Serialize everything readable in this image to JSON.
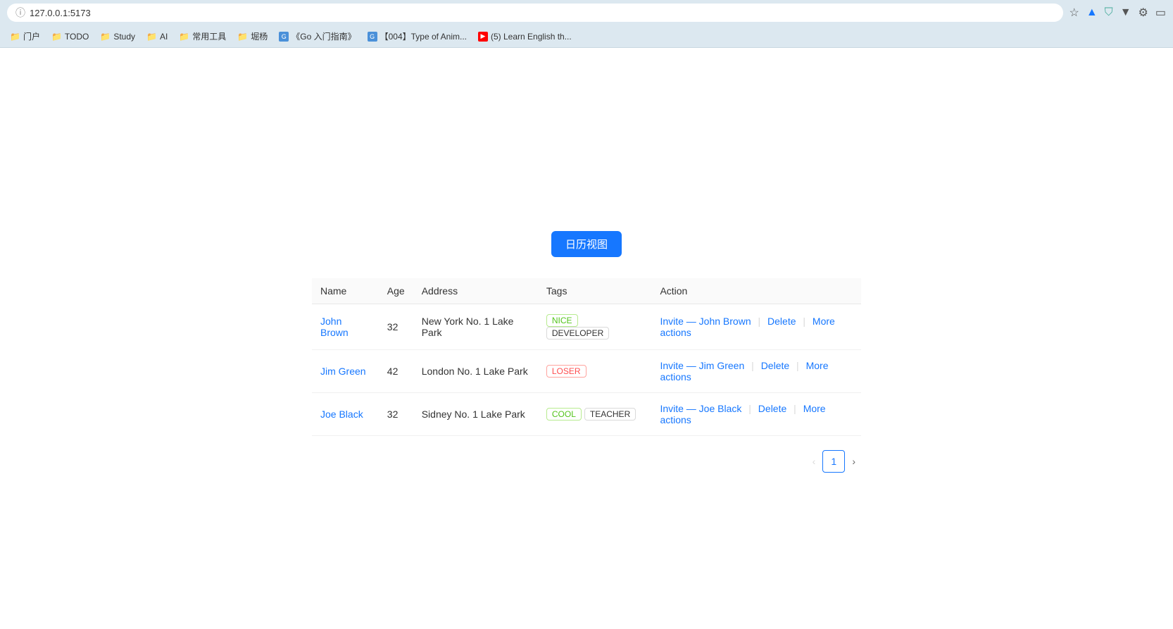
{
  "browser": {
    "address": "127.0.0.1:5173",
    "bookmarks": [
      {
        "label": "门户",
        "type": "folder",
        "color": "yellow"
      },
      {
        "label": "TODO",
        "type": "folder",
        "color": "yellow"
      },
      {
        "label": "Study",
        "type": "folder",
        "color": "yellow"
      },
      {
        "label": "AI",
        "type": "folder",
        "color": "yellow"
      },
      {
        "label": "常用工具",
        "type": "folder",
        "color": "yellow"
      },
      {
        "label": "堀杨",
        "type": "folder",
        "color": "yellow"
      },
      {
        "label": "《Go 入门指南》",
        "type": "favicon",
        "faviconType": "go"
      },
      {
        "label": "【004】Type of Anim...",
        "type": "favicon",
        "faviconType": "go"
      },
      {
        "label": "(5) Learn English th...",
        "type": "favicon",
        "faviconType": "yt"
      }
    ]
  },
  "page": {
    "calendar_button": "日历视图",
    "table": {
      "columns": [
        "Name",
        "Age",
        "Address",
        "Tags",
        "Action"
      ],
      "rows": [
        {
          "name": "John Brown",
          "age": 32,
          "address": "New York No. 1 Lake Park",
          "tags": [
            {
              "label": "NICE",
              "style": "nice"
            },
            {
              "label": "DEVELOPER",
              "style": "developer"
            }
          ],
          "invite_label": "Invite — John Brown",
          "delete_label": "Delete",
          "more_label": "More actions"
        },
        {
          "name": "Jim Green",
          "age": 42,
          "address": "London No. 1 Lake Park",
          "tags": [
            {
              "label": "LOSER",
              "style": "loser"
            }
          ],
          "invite_label": "Invite — Jim Green",
          "delete_label": "Delete",
          "more_label": "More actions"
        },
        {
          "name": "Joe Black",
          "age": 32,
          "address": "Sidney No. 1 Lake Park",
          "tags": [
            {
              "label": "COOL",
              "style": "cool"
            },
            {
              "label": "TEACHER",
              "style": "teacher"
            }
          ],
          "invite_label": "Invite — Joe Black",
          "delete_label": "Delete",
          "more_label": "More actions"
        }
      ]
    },
    "pagination": {
      "prev_label": "‹",
      "next_label": "›",
      "current_page": 1
    }
  }
}
